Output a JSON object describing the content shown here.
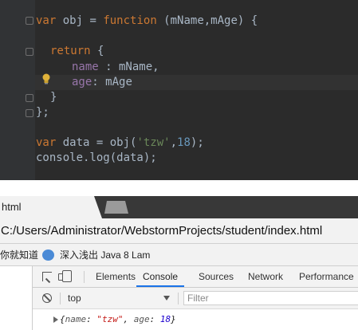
{
  "editor": {
    "lines": [
      {
        "kw": "var",
        "rest1": " obj = ",
        "kw2": "function",
        "rest2": " (mName,mAge) {"
      },
      {
        "kw": "return",
        "rest": " {"
      },
      {
        "prop": "name",
        "rest": " : mName,"
      },
      {
        "prop": "age",
        "rest": ": mAge"
      },
      {
        "text": "}"
      },
      {
        "text": "};",
        "semi": ""
      },
      {
        "kw": "var",
        "rest1": " data = obj(",
        "str": "'tzw'",
        "rest2": ",",
        "num": "18",
        "rest3": ");"
      },
      {
        "text": "console.log(data);"
      }
    ]
  },
  "browser": {
    "tab_title": "html",
    "address": "C:/Users/Administrator/WebstormProjects/student/index.html",
    "bookmarks": [
      "你就知道",
      "深入浅出 Java 8 Lam"
    ]
  },
  "devtools": {
    "tabs": [
      "Elements",
      "Console",
      "Sources",
      "Network",
      "Performance"
    ],
    "active_tab": "Console",
    "context": "top",
    "filter_placeholder": "Filter",
    "output": {
      "open": "{",
      "k1": "name",
      "sep1": ": ",
      "v1": "\"tzw\"",
      "comma": ", ",
      "k2": "age",
      "sep2": ": ",
      "v2": "18",
      "close": "}"
    }
  },
  "colors": {
    "editor_bg": "#2b2b2b",
    "keyword": "#cc7832",
    "string": "#6a8759",
    "number": "#6897bb",
    "property": "#9876aa",
    "accent": "#1a73e8"
  }
}
